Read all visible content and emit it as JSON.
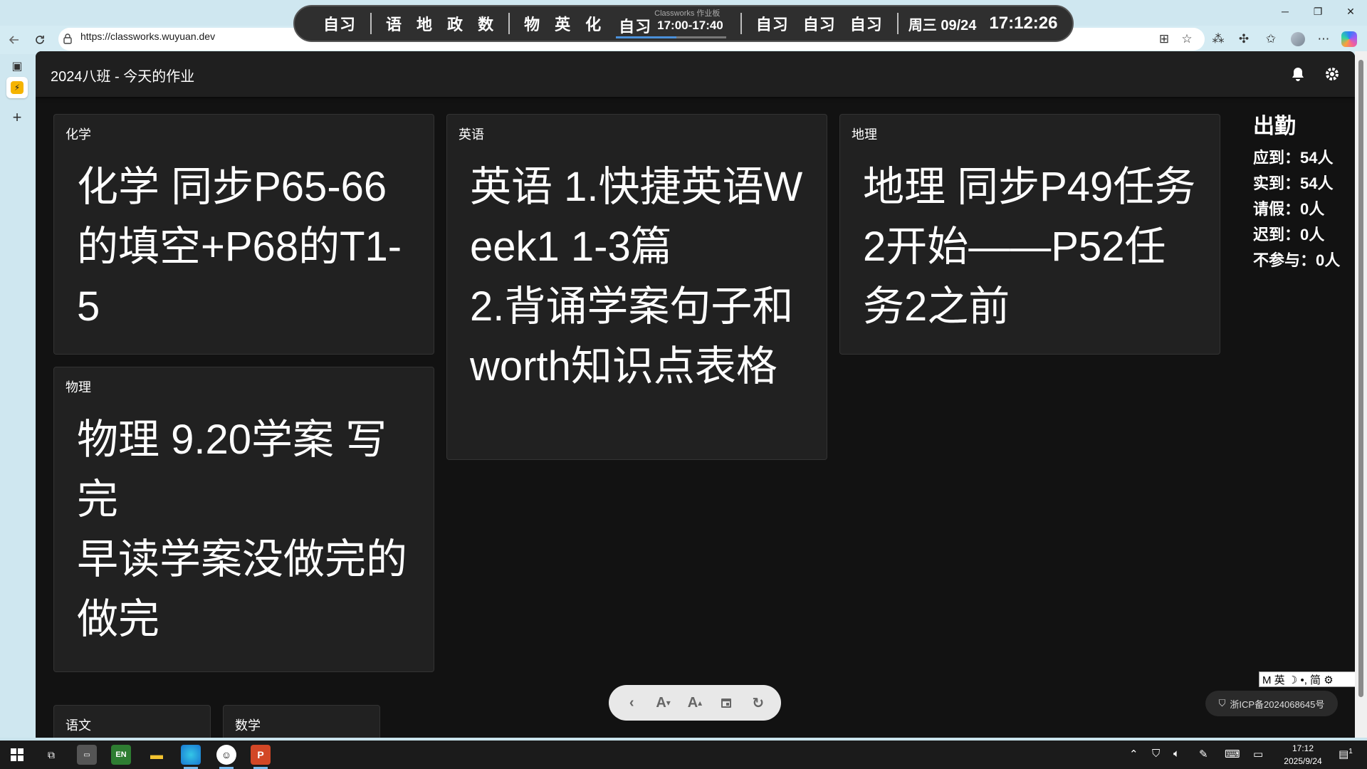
{
  "browser": {
    "url": "https://classworks.wuyuan.dev",
    "window_minimize": "─",
    "window_restore": "❐",
    "window_close": "✕"
  },
  "schedule": {
    "items_a": [
      "自习"
    ],
    "items_b": [
      "语",
      "地",
      "政",
      "数"
    ],
    "items_c": [
      "物",
      "英",
      "化"
    ],
    "current_label": "自习",
    "current_window_title": "Classworks 作业板",
    "current_range": "17:00-17:40",
    "current_progress": 0.55,
    "items_d": [
      "自习",
      "自习",
      "自习"
    ],
    "date": "周三 09/24",
    "time": "17:12:26"
  },
  "app": {
    "title": "2024八班 - 今天的作业"
  },
  "cards": [
    {
      "title": "化学",
      "body": "化学 同步P65-66的填空+P68的T1-5"
    },
    {
      "title": "英语",
      "body": "英语 1.快捷英语Week1 1-3篇\n2.背诵学案句子和worth知识点表格"
    },
    {
      "title": "地理",
      "body": "地理 同步P49任务2开始——P52任务2之前"
    },
    {
      "title": "物理",
      "body": "物理 9.20学案 写完\n早读学案没做完的做完"
    },
    {
      "title": "语文",
      "body": ""
    },
    {
      "title": "数学",
      "body": ""
    }
  ],
  "attendance": {
    "title": "出勤",
    "rows": [
      "应到：54人",
      "实到：54人",
      "请假：0人",
      "迟到：0人",
      "不参与：0人"
    ]
  },
  "toolbar": {
    "icons": [
      "chevron-left-icon",
      "font-decrease-icon",
      "font-increase-icon",
      "calendar-icon",
      "refresh-icon"
    ]
  },
  "icp": "浙ICP备2024068645号",
  "ime": "M 英 ☽ •, 简 ⚙",
  "taskbar": {
    "time": "17:12",
    "date": "2025/9/24",
    "notification_count": "1"
  }
}
